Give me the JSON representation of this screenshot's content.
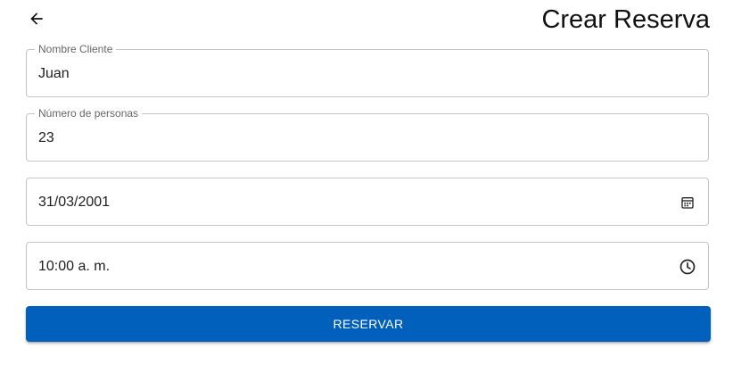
{
  "header": {
    "back_icon": "arrow-left-icon",
    "title": "Crear Reserva"
  },
  "form": {
    "client_name": {
      "label": "Nombre Cliente",
      "value": "Juan"
    },
    "people_count": {
      "label": "Número de personas",
      "value": "23"
    },
    "date": {
      "value": "31/03/2001",
      "icon": "calendar-icon"
    },
    "time": {
      "value": "10:00 a. m.",
      "icon": "clock-icon"
    }
  },
  "actions": {
    "reserve_label": "RESERVAR"
  },
  "colors": {
    "primary": "#0060bc",
    "border": "#c4c4c4",
    "label": "#666666"
  }
}
